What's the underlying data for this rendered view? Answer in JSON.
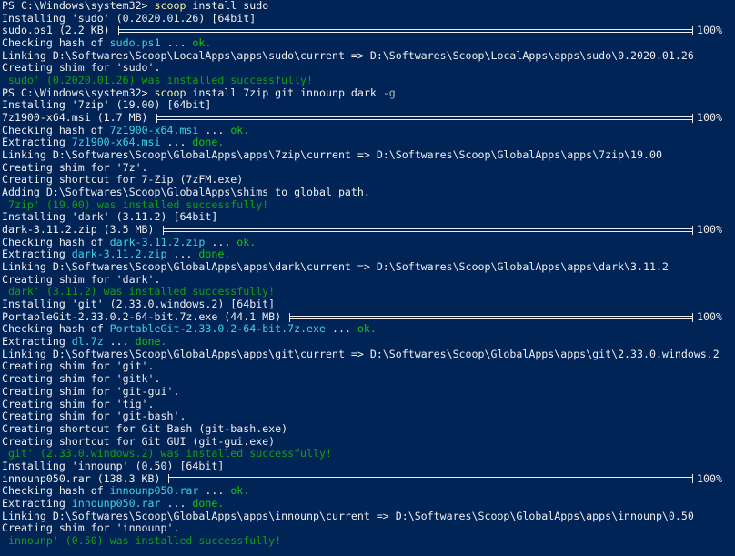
{
  "window": {
    "background": "#012456",
    "colors": {
      "default": "#eeedf0",
      "command": "#f9f1a5",
      "parameter": "#b9b9b9",
      "filename": "#3fd4e6",
      "ok": "#16c60c",
      "success": "#13a10e"
    }
  },
  "lines": [
    {
      "segs": [
        {
          "t": "PS C:\\Windows\\system32> ",
          "c": "default"
        },
        {
          "t": "scoop",
          "c": "yellow"
        },
        {
          "t": " install sudo",
          "c": "default"
        }
      ]
    },
    {
      "segs": [
        {
          "t": "Installing 'sudo' (0.2020.01.26) [64bit]",
          "c": "default"
        }
      ]
    },
    {
      "segs": [
        {
          "t": "sudo.ps1 (2.2 KB) ",
          "c": "default"
        }
      ],
      "progress": {
        "fraction": 1.0,
        "label": "100%"
      }
    },
    {
      "segs": [
        {
          "t": "Checking hash of ",
          "c": "default"
        },
        {
          "t": "sudo.ps1",
          "c": "cyan"
        },
        {
          "t": " ... ",
          "c": "default"
        },
        {
          "t": "ok.",
          "c": "green"
        }
      ]
    },
    {
      "segs": [
        {
          "t": "Linking D:\\Softwares\\Scoop\\LocalApps\\apps\\sudo\\current => D:\\Softwares\\Scoop\\LocalApps\\apps\\sudo\\0.2020.01.26",
          "c": "default"
        }
      ]
    },
    {
      "segs": [
        {
          "t": "Creating shim for 'sudo'.",
          "c": "default"
        }
      ]
    },
    {
      "segs": [
        {
          "t": "'sudo' (0.2020.01.26) was installed successfully!",
          "c": "darkgreen"
        }
      ]
    },
    {
      "segs": [
        {
          "t": "PS C:\\Windows\\system32> ",
          "c": "default"
        },
        {
          "t": "scoop",
          "c": "yellow"
        },
        {
          "t": " install 7zip git innounp dark ",
          "c": "default"
        },
        {
          "t": "-g",
          "c": "gray"
        }
      ]
    },
    {
      "segs": [
        {
          "t": "Installing '7zip' (19.00) [64bit]",
          "c": "default"
        }
      ]
    },
    {
      "segs": [
        {
          "t": "7z1900-x64.msi (1.7 MB) ",
          "c": "default"
        }
      ],
      "progress": {
        "fraction": 1.0,
        "label": "100%"
      }
    },
    {
      "segs": [
        {
          "t": "Checking hash of ",
          "c": "default"
        },
        {
          "t": "7z1900-x64.msi",
          "c": "cyan"
        },
        {
          "t": " ... ",
          "c": "default"
        },
        {
          "t": "ok.",
          "c": "green"
        }
      ]
    },
    {
      "segs": [
        {
          "t": "Extracting ",
          "c": "default"
        },
        {
          "t": "7z1900-x64.msi",
          "c": "cyan"
        },
        {
          "t": " ... ",
          "c": "default"
        },
        {
          "t": "done.",
          "c": "green"
        }
      ]
    },
    {
      "segs": [
        {
          "t": "Linking D:\\Softwares\\Scoop\\GlobalApps\\apps\\7zip\\current => D:\\Softwares\\Scoop\\GlobalApps\\apps\\7zip\\19.00",
          "c": "default"
        }
      ]
    },
    {
      "segs": [
        {
          "t": "Creating shim for '7z'.",
          "c": "default"
        }
      ]
    },
    {
      "segs": [
        {
          "t": "Creating shortcut for 7-Zip (7zFM.exe)",
          "c": "default"
        }
      ]
    },
    {
      "segs": [
        {
          "t": "Adding D:\\Softwares\\Scoop\\GlobalApps\\shims to global path.",
          "c": "default"
        }
      ]
    },
    {
      "segs": [
        {
          "t": "'7zip' (19.00) was installed successfully!",
          "c": "darkgreen"
        }
      ]
    },
    {
      "segs": [
        {
          "t": "Installing 'dark' (3.11.2) [64bit]",
          "c": "default"
        }
      ]
    },
    {
      "segs": [
        {
          "t": "dark-3.11.2.zip (3.5 MB) ",
          "c": "default"
        }
      ],
      "progress": {
        "fraction": 1.0,
        "label": "100%"
      }
    },
    {
      "segs": [
        {
          "t": "Checking hash of ",
          "c": "default"
        },
        {
          "t": "dark-3.11.2.zip",
          "c": "cyan"
        },
        {
          "t": " ... ",
          "c": "default"
        },
        {
          "t": "ok.",
          "c": "green"
        }
      ]
    },
    {
      "segs": [
        {
          "t": "Extracting ",
          "c": "default"
        },
        {
          "t": "dark-3.11.2.zip",
          "c": "cyan"
        },
        {
          "t": " ... ",
          "c": "default"
        },
        {
          "t": "done.",
          "c": "green"
        }
      ]
    },
    {
      "segs": [
        {
          "t": "Linking D:\\Softwares\\Scoop\\GlobalApps\\apps\\dark\\current => D:\\Softwares\\Scoop\\GlobalApps\\apps\\dark\\3.11.2",
          "c": "default"
        }
      ]
    },
    {
      "segs": [
        {
          "t": "Creating shim for 'dark'.",
          "c": "default"
        }
      ]
    },
    {
      "segs": [
        {
          "t": "'dark' (3.11.2) was installed successfully!",
          "c": "darkgreen"
        }
      ]
    },
    {
      "segs": [
        {
          "t": "Installing 'git' (2.33.0.windows.2) [64bit]",
          "c": "default"
        }
      ]
    },
    {
      "segs": [
        {
          "t": "PortableGit-2.33.0.2-64-bit.7z.exe (44.1 MB) ",
          "c": "default"
        }
      ],
      "progress": {
        "fraction": 1.0,
        "label": "100%"
      }
    },
    {
      "segs": [
        {
          "t": "Checking hash of ",
          "c": "default"
        },
        {
          "t": "PortableGit-2.33.0.2-64-bit.7z.exe",
          "c": "cyan"
        },
        {
          "t": " ... ",
          "c": "default"
        },
        {
          "t": "ok.",
          "c": "green"
        }
      ]
    },
    {
      "segs": [
        {
          "t": "Extracting ",
          "c": "default"
        },
        {
          "t": "dl.7z",
          "c": "cyan"
        },
        {
          "t": " ... ",
          "c": "default"
        },
        {
          "t": "done.",
          "c": "green"
        }
      ]
    },
    {
      "segs": [
        {
          "t": "Linking D:\\Softwares\\Scoop\\GlobalApps\\apps\\git\\current => D:\\Softwares\\Scoop\\GlobalApps\\apps\\git\\2.33.0.windows.2",
          "c": "default"
        }
      ]
    },
    {
      "segs": [
        {
          "t": "Creating shim for 'git'.",
          "c": "default"
        }
      ]
    },
    {
      "segs": [
        {
          "t": "Creating shim for 'gitk'.",
          "c": "default"
        }
      ]
    },
    {
      "segs": [
        {
          "t": "Creating shim for 'git-gui'.",
          "c": "default"
        }
      ]
    },
    {
      "segs": [
        {
          "t": "Creating shim for 'tig'.",
          "c": "default"
        }
      ]
    },
    {
      "segs": [
        {
          "t": "Creating shim for 'git-bash'.",
          "c": "default"
        }
      ]
    },
    {
      "segs": [
        {
          "t": "Creating shortcut for Git Bash (git-bash.exe)",
          "c": "default"
        }
      ]
    },
    {
      "segs": [
        {
          "t": "Creating shortcut for Git GUI (git-gui.exe)",
          "c": "default"
        }
      ]
    },
    {
      "segs": [
        {
          "t": "'git' (2.33.0.windows.2) was installed successfully!",
          "c": "darkgreen"
        }
      ]
    },
    {
      "segs": [
        {
          "t": "Installing 'innounp' (0.50) [64bit]",
          "c": "default"
        }
      ]
    },
    {
      "segs": [
        {
          "t": "innounp050.rar (138.3 KB) ",
          "c": "default"
        }
      ],
      "progress": {
        "fraction": 1.0,
        "label": "100%"
      }
    },
    {
      "segs": [
        {
          "t": "Checking hash of ",
          "c": "default"
        },
        {
          "t": "innounp050.rar",
          "c": "cyan"
        },
        {
          "t": " ... ",
          "c": "default"
        },
        {
          "t": "ok.",
          "c": "green"
        }
      ]
    },
    {
      "segs": [
        {
          "t": "Extracting ",
          "c": "default"
        },
        {
          "t": "innounp050.rar",
          "c": "cyan"
        },
        {
          "t": " ... ",
          "c": "default"
        },
        {
          "t": "done.",
          "c": "green"
        }
      ]
    },
    {
      "segs": [
        {
          "t": "Linking D:\\Softwares\\Scoop\\GlobalApps\\apps\\innounp\\current => D:\\Softwares\\Scoop\\GlobalApps\\apps\\innounp\\0.50",
          "c": "default"
        }
      ]
    },
    {
      "segs": [
        {
          "t": "Creating shim for 'innounp'.",
          "c": "default"
        }
      ]
    },
    {
      "segs": [
        {
          "t": "'innounp' (0.50) was installed successfully!",
          "c": "darkgreen"
        }
      ]
    }
  ]
}
